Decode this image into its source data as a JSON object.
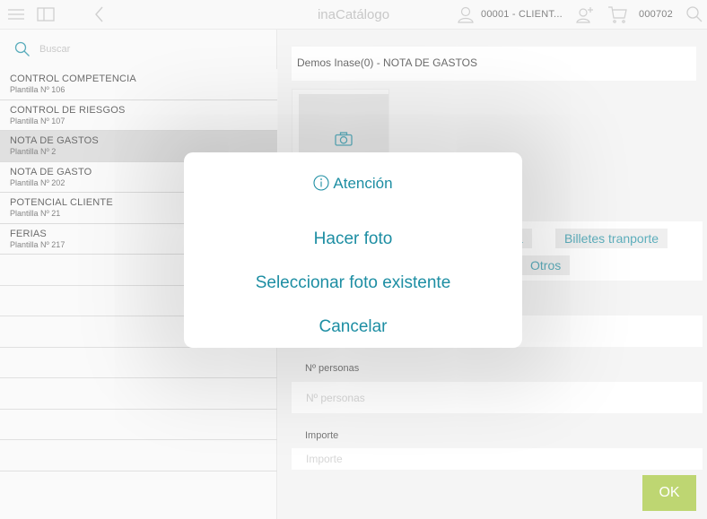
{
  "header": {
    "app_title": "inaCatálogo",
    "client": "00001 - CLIENT...",
    "cart_number": "000702",
    "icons": [
      "menu-icon",
      "split-view-icon",
      "back-chevron-icon",
      "user-icon",
      "add-user-icon",
      "cart-icon",
      "search-icon"
    ]
  },
  "sidebar": {
    "search_placeholder": "Buscar",
    "items": [
      {
        "title": "CONTROL COMPETENCIA",
        "subtitle": "Plantilla Nº 106"
      },
      {
        "title": "CONTROL DE RIESGOS",
        "subtitle": "Plantilla Nº 107"
      },
      {
        "title": "NOTA DE GASTOS",
        "subtitle": "Plantilla Nº 2"
      },
      {
        "title": "NOTA DE GASTO",
        "subtitle": "Plantilla Nº 202"
      },
      {
        "title": "POTENCIAL CLIENTE",
        "subtitle": "Plantilla Nº 21"
      },
      {
        "title": "FERIAS",
        "subtitle": "Plantilla Nº 217"
      }
    ],
    "selected_index": 2
  },
  "main": {
    "document_title": "Demos Inase(0) - NOTA DE GASTOS",
    "chips": [
      "a",
      "Billetes tranporte",
      "Otros"
    ],
    "personas_label": "Nº personas",
    "personas_placeholder": "Nº personas",
    "importe_label": "Importe",
    "importe_placeholder": "Importe",
    "ok_label": "OK"
  },
  "dialog": {
    "title": "Atención",
    "take_photo": "Hacer foto",
    "choose_photo": "Seleccionar foto existente",
    "cancel": "Cancelar"
  },
  "colors": {
    "accent": "#1d8ea3",
    "ok_button": "#a6c73c",
    "selected_row": "#d5d5d5"
  }
}
